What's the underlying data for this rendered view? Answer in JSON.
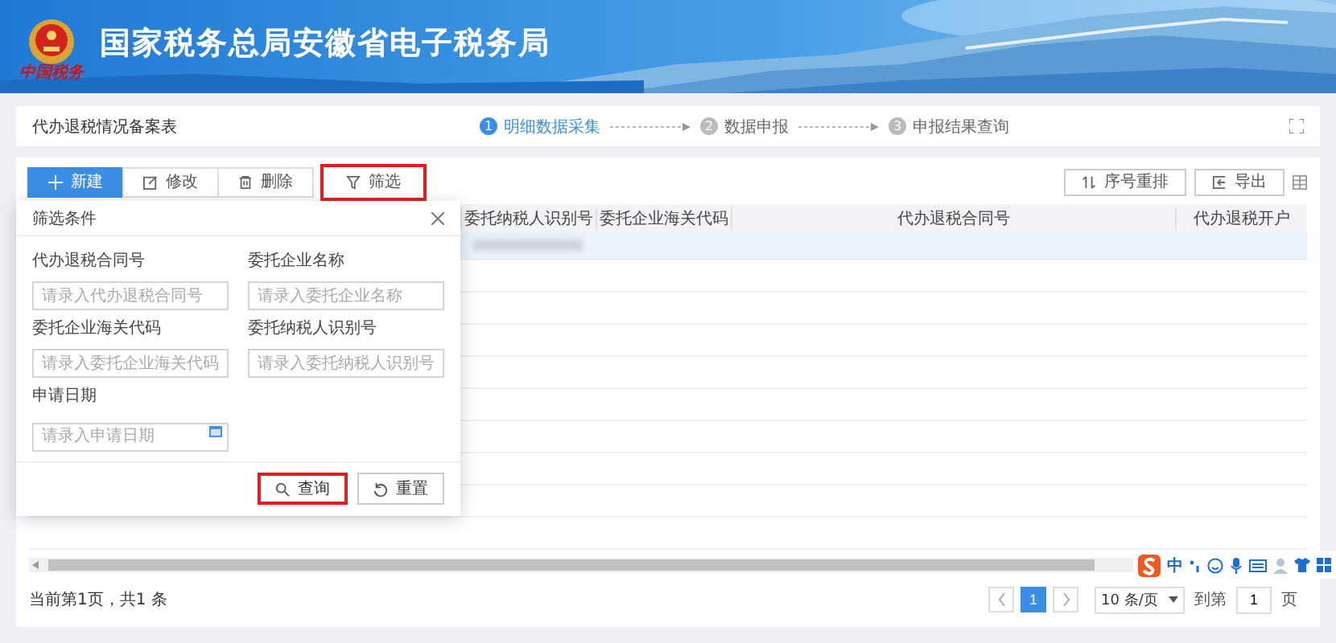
{
  "header": {
    "title": "国家税务总局安徽省电子税务局",
    "logo_text": "中国税务"
  },
  "step_bar": {
    "title": "代办退税情况备案表",
    "steps": [
      {
        "number": "1",
        "label": "明细数据采集",
        "selected": true
      },
      {
        "number": "2",
        "label": "数据申报",
        "selected": false
      },
      {
        "number": "3",
        "label": "申报结果查询",
        "selected": false
      }
    ]
  },
  "toolbar": {
    "buttons": [
      {
        "label": "新建",
        "kind": "primary",
        "highlighted": false
      },
      {
        "label": "修改",
        "kind": "plain",
        "highlighted": false
      },
      {
        "label": "删除",
        "kind": "plain",
        "highlighted": false
      },
      {
        "label": "筛选",
        "kind": "plain",
        "highlighted": true
      }
    ],
    "right_buttons": [
      {
        "label": "序号重排"
      },
      {
        "label": "导出"
      }
    ]
  },
  "table": {
    "columns": [
      "委托纳税人识别号",
      "委托企业海关代码",
      "代办退税合同号",
      "代办退税开户"
    ],
    "rows": [
      {
        "selected": true
      }
    ]
  },
  "filter_panel": {
    "title": "筛选条件",
    "fields": [
      {
        "label": "代办退税合同号",
        "placeholder": "请录入代办退税合同号",
        "kind": "text"
      },
      {
        "label": "委托企业名称",
        "placeholder": "请录入委托企业名称",
        "kind": "text"
      },
      {
        "label": "委托企业海关代码",
        "placeholder": "请录入委托企业海关代码",
        "kind": "text"
      },
      {
        "label": "委托纳税人识别号",
        "placeholder": "请录入委托纳税人识别号",
        "kind": "text"
      },
      {
        "label": "申请日期",
        "placeholder": "请录入申请日期",
        "kind": "date"
      }
    ],
    "buttons": [
      {
        "label": "查询",
        "highlighted": true
      },
      {
        "label": "重置",
        "highlighted": false
      }
    ]
  },
  "pagination": {
    "summary": "当前第1页，共1 条",
    "pages": [
      {
        "label": "1",
        "selected": true
      }
    ],
    "page_size": "10 条/页",
    "goto_label": "到第",
    "goto_value": "1",
    "goto_suffix": "页"
  },
  "ime_toolbar": {
    "mode": "中"
  }
}
